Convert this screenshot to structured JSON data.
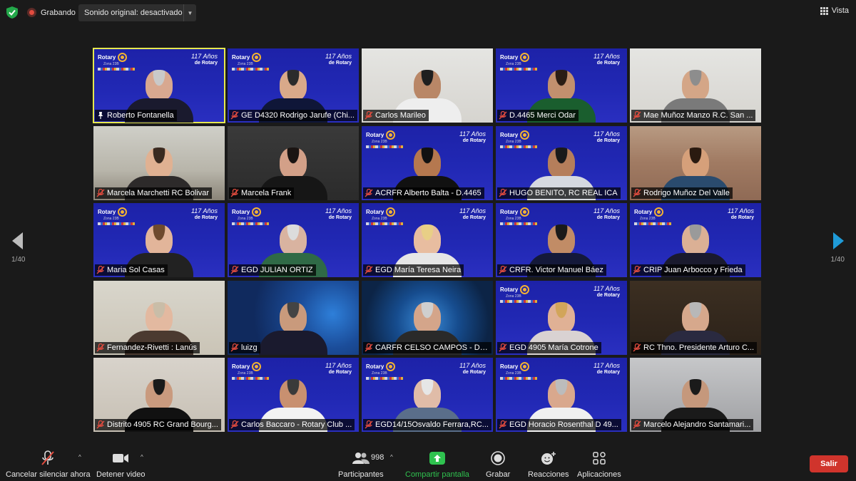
{
  "topbar": {
    "recording_label": "Grabando",
    "audio_select_value": "Sonido original: desactivado",
    "view_label": "Vista"
  },
  "pager": {
    "left": "1/40",
    "right": "1/40"
  },
  "participants": [
    {
      "name": "Roberto Fontanella",
      "bg": "rotary",
      "mic": "pin",
      "skin": "#d8a890",
      "shirt": "#1a1a2e",
      "hair": "#c9c9c9",
      "active": true
    },
    {
      "name": "GE D4320 Rodrigo Jarufe (Chi...",
      "bg": "rotary",
      "mic": "muted",
      "skin": "#d9a98a",
      "shirt": "#0f1638",
      "hair": "#2b2b2b"
    },
    {
      "name": "Carlos Marileo",
      "bg": "room5",
      "mic": "muted",
      "skin": "#b98767",
      "shirt": "#eeeeee",
      "hair": "#1f1f1f"
    },
    {
      "name": "D.4465 Merci Odar",
      "bg": "rotary",
      "mic": "muted",
      "skin": "#c2906e",
      "shirt": "#1a5e2e",
      "hair": "#2a1d15"
    },
    {
      "name": "Mae Muñoz Manzo  R.C. San ...",
      "bg": "room5",
      "mic": "muted",
      "skin": "#d4a687",
      "shirt": "#7a7a7a",
      "hair": "#8d8d8d"
    },
    {
      "name": "Marcela Marchetti RC Bolivar",
      "bg": "room1",
      "mic": "muted",
      "skin": "#e0b192",
      "shirt": "#2d2a2a",
      "hair": "#3a2a20"
    },
    {
      "name": "Marcela Frank",
      "bg": "room2",
      "mic": "muted",
      "skin": "#d3a088",
      "shirt": "#161616",
      "hair": "#1a1412"
    },
    {
      "name": "ACRFR Alberto Balta - D.4465",
      "bg": "rotary",
      "mic": "muted",
      "skin": "#b5784f",
      "shirt": "#111111",
      "hair": "#111111"
    },
    {
      "name": "HUGO BENITO, RC REAL ICA",
      "bg": "rotary",
      "mic": "muted",
      "skin": "#b57e5b",
      "shirt": "#d5d9e0",
      "hair": "#1a1a1a"
    },
    {
      "name": "Rodrigo Muñoz Del Valle",
      "bg": "room4",
      "mic": "muted",
      "skin": "#d6a07a",
      "shirt": "#2a4b6e",
      "hair": "#2a1a10"
    },
    {
      "name": "Maria Sol Casas",
      "bg": "rotary",
      "mic": "muted",
      "skin": "#e2b59a",
      "shirt": "#222222",
      "hair": "#6e4a2e"
    },
    {
      "name": "EGD JULIAN ORTIZ",
      "bg": "rotary",
      "mic": "muted",
      "skin": "#d9b3a0",
      "shirt": "#2f6a46",
      "hair": "#dcdcdc"
    },
    {
      "name": "EGD María Teresa Neira",
      "bg": "rotary",
      "mic": "muted",
      "skin": "#e8bda0",
      "shirt": "#e6e6e6",
      "hair": "#e8cf86"
    },
    {
      "name": "CRFR. Victor Manuel Báez",
      "bg": "rotary",
      "mic": "muted",
      "skin": "#c18c66",
      "shirt": "#14193a",
      "hair": "#1a1a1a"
    },
    {
      "name": "CRIP Juan Arbocco y Frieda",
      "bg": "rotary",
      "mic": "muted",
      "skin": "#dbb095",
      "shirt": "#1a1a2e",
      "hair": "#9a9a9a"
    },
    {
      "name": "Fernandez-Rivetti : Lanús",
      "bg": "room3",
      "mic": "muted",
      "skin": "#e3b9a0",
      "shirt": "#4b3a30",
      "hair": "#c9bda8"
    },
    {
      "name": "luizg",
      "bg": "globe",
      "mic": "muted",
      "skin": "#c99a7c",
      "shirt": "#1a1a2e",
      "hair": "#444444"
    },
    {
      "name": "CARFR CELSO CAMPOS - D46...",
      "bg": "net",
      "mic": "muted",
      "skin": "#d4a58a",
      "shirt": "#2a2a2a",
      "hair": "#cfcfcf"
    },
    {
      "name": "EGD 4905 María Cotrone",
      "bg": "rotary",
      "mic": "muted",
      "skin": "#e0b195",
      "shirt": "#d9d2d2",
      "hair": "#d2a55a"
    },
    {
      "name": "RC Thno. Presidente Arturo C...",
      "bg": "room6",
      "mic": "muted",
      "skin": "#d6a88c",
      "shirt": "#2a2a40",
      "hair": "#b8b8b8"
    },
    {
      "name": "Distrito 4905 RC Grand Bourg...",
      "bg": "room7",
      "mic": "muted",
      "skin": "#c99a7e",
      "shirt": "#111111",
      "hair": "#1a1a1a"
    },
    {
      "name": "Carlos Baccaro - Rotary Club ...",
      "bg": "rotary",
      "mic": "muted",
      "skin": "#c89070",
      "shirt": "#f2f2f2",
      "hair": "#3a3a3a"
    },
    {
      "name": "EGD14/15Osvaldo Ferrara,RC...",
      "bg": "rotary",
      "mic": "muted",
      "skin": "#e0bca8",
      "shirt": "#5a6e8a",
      "hair": "#e6e6e6"
    },
    {
      "name": "EGD Horacio Rosenthal  D 49...",
      "bg": "rotary",
      "mic": "muted",
      "skin": "#d9a88d",
      "shirt": "#f0f0f0",
      "hair": "#bcbcbc"
    },
    {
      "name": "Marcelo Alejandro Santamari...",
      "bg": "room8",
      "mic": "muted",
      "skin": "#c5987c",
      "shirt": "#1a1a1a",
      "hair": "#1a1a1a"
    }
  ],
  "rotary_overlay": {
    "brand": "Rotary",
    "zone": "Zona 23B",
    "years": "117 Años",
    "years_sub": "de Rotary"
  },
  "toolbar": {
    "mute_label": "Cancelar silenciar ahora",
    "video_label": "Detener video",
    "participants_label": "Participantes",
    "participants_count": "998",
    "share_label": "Compartir pantalla",
    "record_label": "Grabar",
    "reactions_label": "Reacciones",
    "apps_label": "Aplicaciones",
    "leave_label": "Salir"
  },
  "colors": {
    "accent_green": "#2fc24f",
    "leave_red": "#d0342c",
    "active_speaker": "#e6e84f",
    "rotary_blue": "#1d22a8",
    "nav_blue": "#1f9bd8"
  }
}
